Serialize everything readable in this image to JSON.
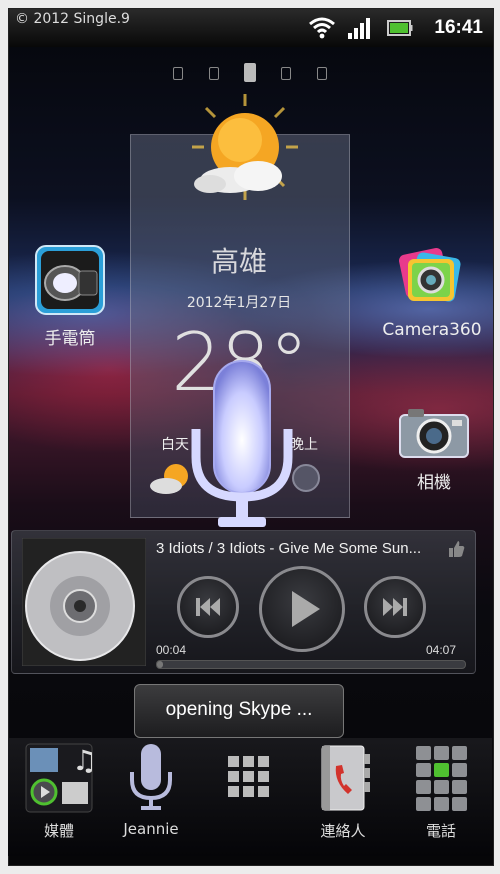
{
  "watermark": "© 2012 Single.9",
  "status": {
    "time": "16:41"
  },
  "page_indicator": {
    "total": 5,
    "active_index": 2
  },
  "weather": {
    "city": "高雄",
    "date": "2012年1月27日",
    "temperature": "28°",
    "day_label": "白天",
    "night_label": "晚上"
  },
  "apps": {
    "flashlight": "手電筒",
    "camera360": "Camera360",
    "camera": "相機"
  },
  "music": {
    "track": "3 Idiots / 3 Idiots - Give Me Some Sun...",
    "elapsed": "00:04",
    "total": "04:07",
    "progress": 0.016
  },
  "toast": "opening Skype ...",
  "dock": {
    "media": "媒體",
    "jeannie": "Jeannie",
    "contacts": "連絡人",
    "phone": "電話"
  },
  "colors": {
    "accent_green": "#4fc030",
    "mic_glow": "#c9ccff"
  }
}
